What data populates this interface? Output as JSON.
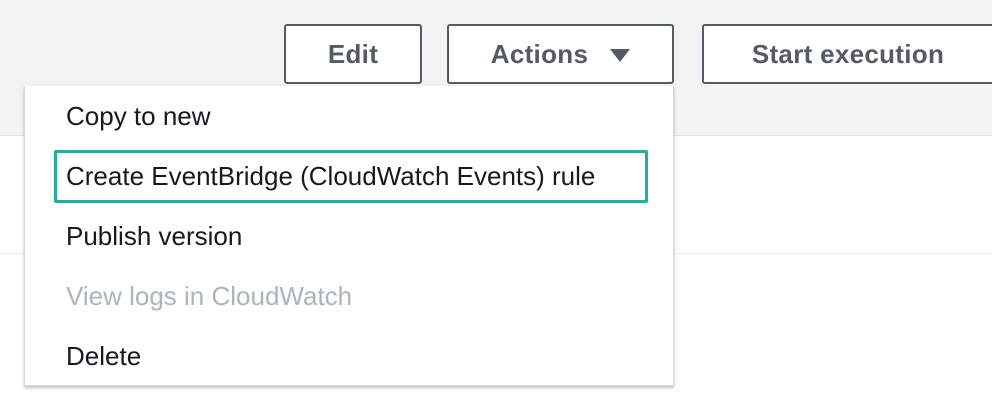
{
  "toolbar": {
    "edit_label": "Edit",
    "actions_label": "Actions",
    "start_execution_label": "Start execution"
  },
  "icons": {
    "actions_caret": "caret-down-icon"
  },
  "colors": {
    "highlight_border": "#1ab3a0",
    "button_text": "#545b64",
    "disabled_text": "#aab7b8"
  },
  "actions_menu": {
    "items": [
      {
        "label": "Copy to new",
        "enabled": true
      },
      {
        "label": "Create EventBridge (CloudWatch Events) rule",
        "enabled": true,
        "highlighted": true
      },
      {
        "label": "Publish version",
        "enabled": true
      },
      {
        "label": "View logs in CloudWatch",
        "enabled": false
      },
      {
        "label": "Delete",
        "enabled": true
      }
    ]
  }
}
